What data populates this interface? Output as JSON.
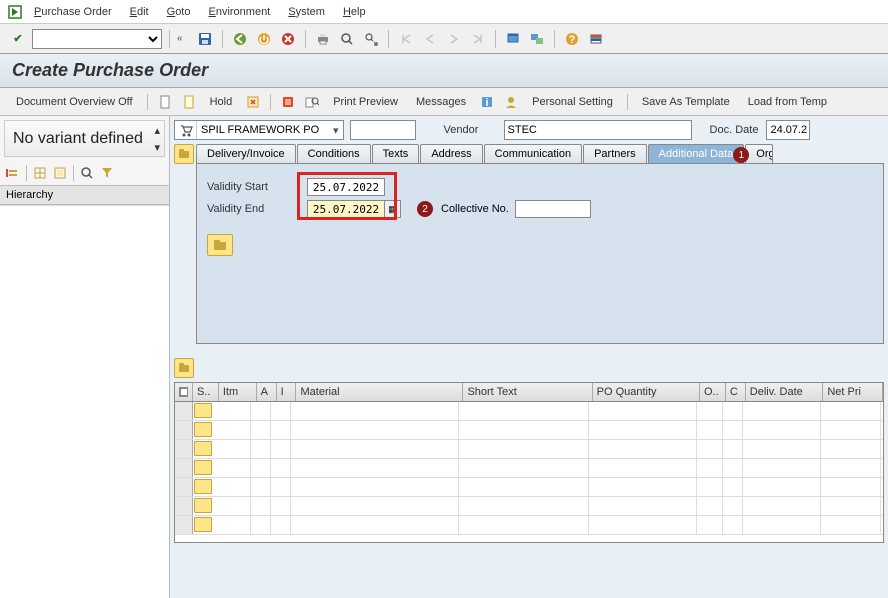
{
  "menu": {
    "items": [
      "Purchase Order",
      "Edit",
      "Goto",
      "Environment",
      "System",
      "Help"
    ]
  },
  "title": "Create Purchase Order",
  "subtoolbar": {
    "docOverview": "Document Overview Off",
    "hold": "Hold",
    "printPreview": "Print Preview",
    "messages": "Messages",
    "personalSetting": "Personal Setting",
    "saveTemplate": "Save As Template",
    "loadTemplate": "Load from Temp"
  },
  "sidebar": {
    "variantTitle": "No variant defined",
    "hierarchy": "Hierarchy"
  },
  "header": {
    "poType": "SPIL FRAMEWORK PO",
    "poNumber": "",
    "vendorLabel": "Vendor",
    "vendorValue": "STEC",
    "docDateLabel": "Doc. Date",
    "docDateValue": "24.07.2"
  },
  "tabs": [
    "Delivery/Invoice",
    "Conditions",
    "Texts",
    "Address",
    "Communication",
    "Partners",
    "Additional Data",
    "Org."
  ],
  "annotations": {
    "badge1": "1",
    "badge2": "2"
  },
  "panel": {
    "validityStartLabel": "Validity Start",
    "validityStart": "25.07.2022",
    "validityEndLabel": "Validity End",
    "validityEnd": "25.07.2022",
    "collectiveLabel": "Collective No.",
    "collectiveNo": ""
  },
  "grid": {
    "columns": [
      "",
      "S..",
      "Itm",
      "A",
      "I",
      "Material",
      "Short Text",
      "PO Quantity",
      "O..",
      "C",
      "Deliv. Date",
      "Net Pri"
    ]
  }
}
